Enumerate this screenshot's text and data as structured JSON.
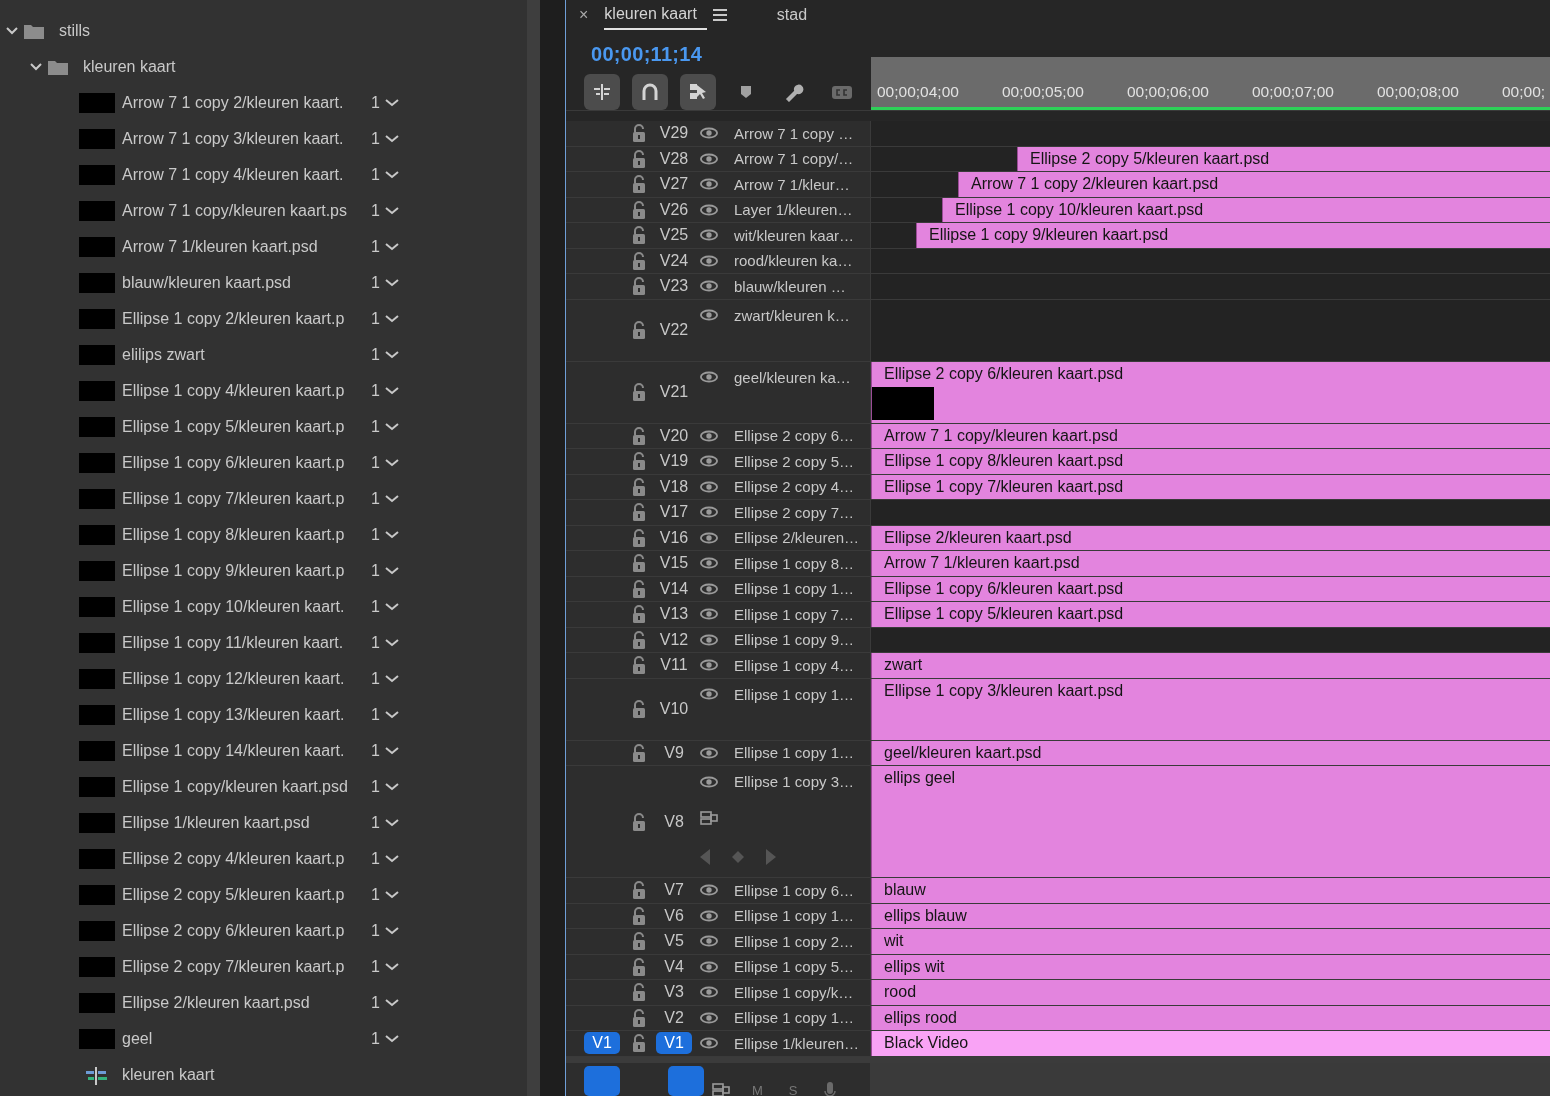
{
  "project": {
    "items": [
      {
        "kind": "folder",
        "name": "stills",
        "expanded": true,
        "children": [
          {
            "kind": "folder",
            "name": "kleuren kaart",
            "expanded": true,
            "children": [
              {
                "kind": "still",
                "name": "Arrow 7 1 copy 2/kleuren kaart.",
                "count": "1"
              },
              {
                "kind": "still",
                "name": "Arrow 7 1 copy 3/kleuren kaart.",
                "count": "1"
              },
              {
                "kind": "still",
                "name": "Arrow 7 1 copy 4/kleuren kaart.",
                "count": "1"
              },
              {
                "kind": "still",
                "name": "Arrow 7 1 copy/kleuren kaart.ps",
                "count": "1"
              },
              {
                "kind": "still",
                "name": "Arrow 7 1/kleuren kaart.psd",
                "count": "1"
              },
              {
                "kind": "still",
                "name": "blauw/kleuren kaart.psd",
                "count": "1"
              },
              {
                "kind": "still",
                "name": "Ellipse 1 copy 2/kleuren kaart.p",
                "count": "1"
              },
              {
                "kind": "still",
                "name": "elilips zwart",
                "count": "1"
              },
              {
                "kind": "still",
                "name": "Ellipse 1 copy 4/kleuren kaart.p",
                "count": "1"
              },
              {
                "kind": "still",
                "name": "Ellipse 1 copy 5/kleuren kaart.p",
                "count": "1"
              },
              {
                "kind": "still",
                "name": "Ellipse 1 copy 6/kleuren kaart.p",
                "count": "1"
              },
              {
                "kind": "still",
                "name": "Ellipse 1 copy 7/kleuren kaart.p",
                "count": "1"
              },
              {
                "kind": "still",
                "name": "Ellipse 1 copy 8/kleuren kaart.p",
                "count": "1"
              },
              {
                "kind": "still",
                "name": "Ellipse 1 copy 9/kleuren kaart.p",
                "count": "1"
              },
              {
                "kind": "still",
                "name": "Ellipse 1 copy 10/kleuren kaart.",
                "count": "1"
              },
              {
                "kind": "still",
                "name": "Ellipse 1 copy 11/kleuren kaart.",
                "count": "1"
              },
              {
                "kind": "still",
                "name": "Ellipse 1 copy 12/kleuren kaart.",
                "count": "1"
              },
              {
                "kind": "still",
                "name": "Ellipse 1 copy 13/kleuren kaart.",
                "count": "1"
              },
              {
                "kind": "still",
                "name": "Ellipse 1 copy 14/kleuren kaart.",
                "count": "1"
              },
              {
                "kind": "still",
                "name": "Ellipse 1 copy/kleuren kaart.psd",
                "count": "1"
              },
              {
                "kind": "still",
                "name": "Ellipse 1/kleuren kaart.psd",
                "count": "1"
              },
              {
                "kind": "still",
                "name": "Ellipse 2 copy 4/kleuren kaart.p",
                "count": "1"
              },
              {
                "kind": "still",
                "name": "Ellipse 2 copy 5/kleuren kaart.p",
                "count": "1"
              },
              {
                "kind": "still",
                "name": "Ellipse 2 copy 6/kleuren kaart.p",
                "count": "1"
              },
              {
                "kind": "still",
                "name": "Ellipse 2 copy 7/kleuren kaart.p",
                "count": "1"
              },
              {
                "kind": "still",
                "name": "Ellipse 2/kleuren kaart.psd",
                "count": "1"
              },
              {
                "kind": "still",
                "name": "geel",
                "count": "1"
              },
              {
                "kind": "sequence",
                "name": "kleuren kaart"
              }
            ]
          }
        ]
      }
    ]
  },
  "timeline": {
    "close": "×",
    "tabs": [
      {
        "label": "kleuren kaart",
        "selected": true
      },
      {
        "label": "stad",
        "selected": false
      }
    ],
    "timecode": "00;00;11;14",
    "toolbar": [
      {
        "kind": "insert",
        "on": true
      },
      {
        "kind": "snap",
        "on": true
      },
      {
        "kind": "linked",
        "on": true
      },
      {
        "kind": "marker",
        "on": false
      },
      {
        "kind": "settings",
        "on": false
      },
      {
        "kind": "captions",
        "on": false
      }
    ],
    "ruler": [
      "00;00;04;00",
      "00;00;05;00",
      "00;00;06;00",
      "00;00;07;00",
      "00;00;08;00",
      "00;00;"
    ],
    "tracks": [
      {
        "label": "V29",
        "name": "Arrow 7 1 copy …",
        "targeted": false,
        "expanded": false
      },
      {
        "label": "V28",
        "name": "Arrow 7 1 copy/…",
        "targeted": false,
        "expanded": false,
        "clips": [
          {
            "label": "Ellipse 2 copy 5/kleuren kaart.psd",
            "selected": false
          }
        ]
      },
      {
        "label": "V27",
        "name": "Arrow 7 1/kleur…",
        "targeted": false,
        "expanded": false,
        "clips": [
          {
            "label": "Arrow 7 1 copy 2/kleuren kaart.psd",
            "selected": false
          }
        ]
      },
      {
        "label": "V26",
        "name": "Layer 1/kleuren…",
        "targeted": false,
        "expanded": false,
        "clips": [
          {
            "label": "Ellipse 1 copy 10/kleuren kaart.psd",
            "selected": false
          }
        ]
      },
      {
        "label": "V25",
        "name": "wit/kleuren kaar…",
        "targeted": false,
        "expanded": false,
        "clips": [
          {
            "label": "Ellipse 1 copy 9/kleuren kaart.psd",
            "selected": false
          }
        ]
      },
      {
        "label": "V24",
        "name": "rood/kleuren ka…",
        "targeted": false,
        "expanded": false
      },
      {
        "label": "V23",
        "name": "blauw/kleuren …",
        "targeted": false,
        "expanded": false
      },
      {
        "label": "V22",
        "name": "zwart/kleuren k…",
        "targeted": false,
        "expanded": true
      },
      {
        "label": "V21",
        "name": "geel/kleuren ka…",
        "targeted": false,
        "expanded": true,
        "clips": [
          {
            "label": "Ellipse 2 copy 6/kleuren kaart.psd",
            "selected": false,
            "thumbnail": true
          }
        ]
      },
      {
        "label": "V20",
        "name": "Ellipse 2 copy 6…",
        "targeted": false,
        "expanded": false,
        "clips": [
          {
            "label": "Arrow 7 1 copy/kleuren kaart.psd",
            "selected": false
          }
        ]
      },
      {
        "label": "V19",
        "name": "Ellipse 2 copy 5…",
        "targeted": false,
        "expanded": false,
        "clips": [
          {
            "label": "Ellipse 1 copy 8/kleuren kaart.psd",
            "selected": false
          }
        ]
      },
      {
        "label": "V18",
        "name": "Ellipse 2 copy 4…",
        "targeted": false,
        "expanded": false,
        "clips": [
          {
            "label": "Ellipse 1 copy 7/kleuren kaart.psd",
            "selected": false
          }
        ]
      },
      {
        "label": "V17",
        "name": "Ellipse 2 copy 7…",
        "targeted": false,
        "expanded": false
      },
      {
        "label": "V16",
        "name": "Ellipse 2/kleuren…",
        "targeted": false,
        "expanded": false,
        "clips": [
          {
            "label": "Ellipse 2/kleuren kaart.psd",
            "selected": false
          }
        ]
      },
      {
        "label": "V15",
        "name": "Ellipse 1 copy 8…",
        "targeted": false,
        "expanded": false,
        "clips": [
          {
            "label": "Arrow 7 1/kleuren kaart.psd",
            "selected": false
          }
        ]
      },
      {
        "label": "V14",
        "name": "Ellipse 1 copy 1…",
        "targeted": false,
        "expanded": false,
        "clips": [
          {
            "label": "Ellipse 1 copy 6/kleuren kaart.psd",
            "selected": false
          }
        ]
      },
      {
        "label": "V13",
        "name": "Ellipse 1 copy 7…",
        "targeted": false,
        "expanded": false,
        "clips": [
          {
            "label": "Ellipse 1 copy 5/kleuren kaart.psd",
            "selected": false
          }
        ]
      },
      {
        "label": "V12",
        "name": "Ellipse 1 copy 9…",
        "targeted": false,
        "expanded": false
      },
      {
        "label": "V11",
        "name": "Ellipse 1 copy 4…",
        "targeted": false,
        "expanded": false,
        "clips": [
          {
            "label": "zwart",
            "selected": false
          }
        ]
      },
      {
        "label": "V10",
        "name": "Ellipse 1 copy 1…",
        "targeted": false,
        "expanded": true,
        "clips": [
          {
            "label": "Ellipse 1 copy 3/kleuren kaart.psd",
            "selected": false
          }
        ]
      },
      {
        "label": "V9",
        "name": "Ellipse 1 copy 1…",
        "targeted": false,
        "expanded": false,
        "clips": [
          {
            "label": "geel/kleuren kaart.psd",
            "selected": false
          }
        ]
      },
      {
        "label": "V8",
        "name": "Ellipse 1 copy 3…",
        "targeted": false,
        "expanded": true,
        "keyframes": true,
        "clips": [
          {
            "label": "ellips geel",
            "selected": false
          }
        ]
      },
      {
        "label": "V7",
        "name": "Ellipse 1 copy 6…",
        "targeted": false,
        "expanded": false,
        "clips": [
          {
            "label": "blauw",
            "selected": false
          }
        ]
      },
      {
        "label": "V6",
        "name": "Ellipse 1 copy 1…",
        "targeted": false,
        "expanded": false,
        "clips": [
          {
            "label": "ellips blauw",
            "selected": false
          }
        ]
      },
      {
        "label": "V5",
        "name": "Ellipse 1 copy 2…",
        "targeted": false,
        "expanded": false,
        "clips": [
          {
            "label": "wit",
            "selected": false
          }
        ]
      },
      {
        "label": "V4",
        "name": "Ellipse 1 copy 5…",
        "targeted": false,
        "expanded": false,
        "clips": [
          {
            "label": "ellips wit",
            "selected": false
          }
        ]
      },
      {
        "label": "V3",
        "name": "Ellipse 1 copy/k…",
        "targeted": false,
        "expanded": false,
        "clips": [
          {
            "label": "rood",
            "selected": false
          }
        ]
      },
      {
        "label": "V2",
        "name": "Ellipse 1 copy 1…",
        "targeted": false,
        "expanded": false,
        "clips": [
          {
            "label": "ellips rood",
            "selected": false
          }
        ]
      },
      {
        "label": "V1",
        "name": "Ellipse 1/kleuren…",
        "targeted": true,
        "source_patch": "V1",
        "expanded": false,
        "clips": [
          {
            "label": "Black Video",
            "selected": true
          }
        ]
      }
    ],
    "audio_track": {
      "mute": "M",
      "solo": "S"
    }
  }
}
